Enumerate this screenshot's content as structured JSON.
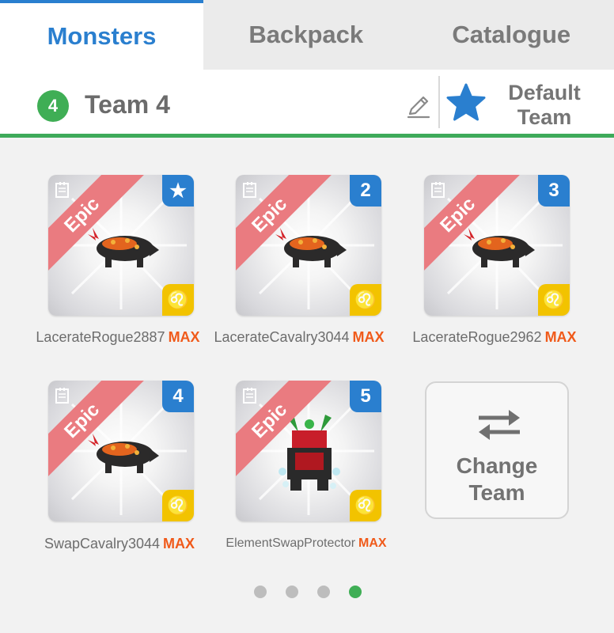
{
  "tabs": [
    {
      "label": "Monsters",
      "active": true
    },
    {
      "label": "Backpack",
      "active": false
    },
    {
      "label": "Catalogue",
      "active": false
    }
  ],
  "team": {
    "number": "4",
    "name": "Team 4",
    "default_label": "Default Team",
    "edit_icon": "pencil-icon",
    "default_icon": "star-icon"
  },
  "monsters": [
    {
      "name": "LacerateRogue2887",
      "max": "MAX",
      "rarity": "Epic",
      "slot": "★",
      "element": "♌"
    },
    {
      "name": "LacerateCavalry3044",
      "max": "MAX",
      "rarity": "Epic",
      "slot": "2",
      "element": "♌"
    },
    {
      "name": "LacerateRogue2962",
      "max": "MAX",
      "rarity": "Epic",
      "slot": "3",
      "element": "♌"
    },
    {
      "name": "SwapCavalry3044",
      "max": "MAX",
      "rarity": "Epic",
      "slot": "4",
      "element": "♌"
    },
    {
      "name": "ElementSwapProtector",
      "max": "MAX",
      "rarity": "Epic",
      "slot": "5",
      "element": "♌"
    }
  ],
  "change_team": {
    "label": "Change Team",
    "icon": "swap-arrows-icon"
  },
  "pagination": {
    "pages": 4,
    "current": 4
  },
  "colors": {
    "accent": "#2a7fcf",
    "green": "#3fae55",
    "epic": "#ea7b80",
    "max": "#f05a1a",
    "element_badge": "#f2c300"
  }
}
